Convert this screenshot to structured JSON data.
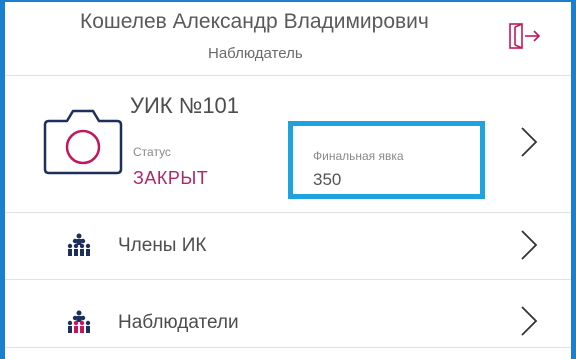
{
  "user": {
    "name": "Кошелев Александр Владимирович",
    "role": "Наблюдатель"
  },
  "polling_station": {
    "title": "УИК №101",
    "status_label": "Статус",
    "status_value": "ЗАКРЫТ",
    "turnout_label": "Финальная явка",
    "turnout_value": "350"
  },
  "menu": {
    "members_label": "Члены ИК",
    "observers_label": "Наблюдатели"
  },
  "colors": {
    "frame": "#1b7fd0",
    "highlight": "#1fa3df",
    "status": "#b0266b",
    "icon_dark": "#1f2f5c",
    "icon_accent": "#c2185b"
  },
  "icons": {
    "logout": "logout-icon",
    "camera": "camera-icon",
    "members": "people-group-icon",
    "observers": "people-group-icon",
    "chevron": "chevron-right-icon"
  }
}
